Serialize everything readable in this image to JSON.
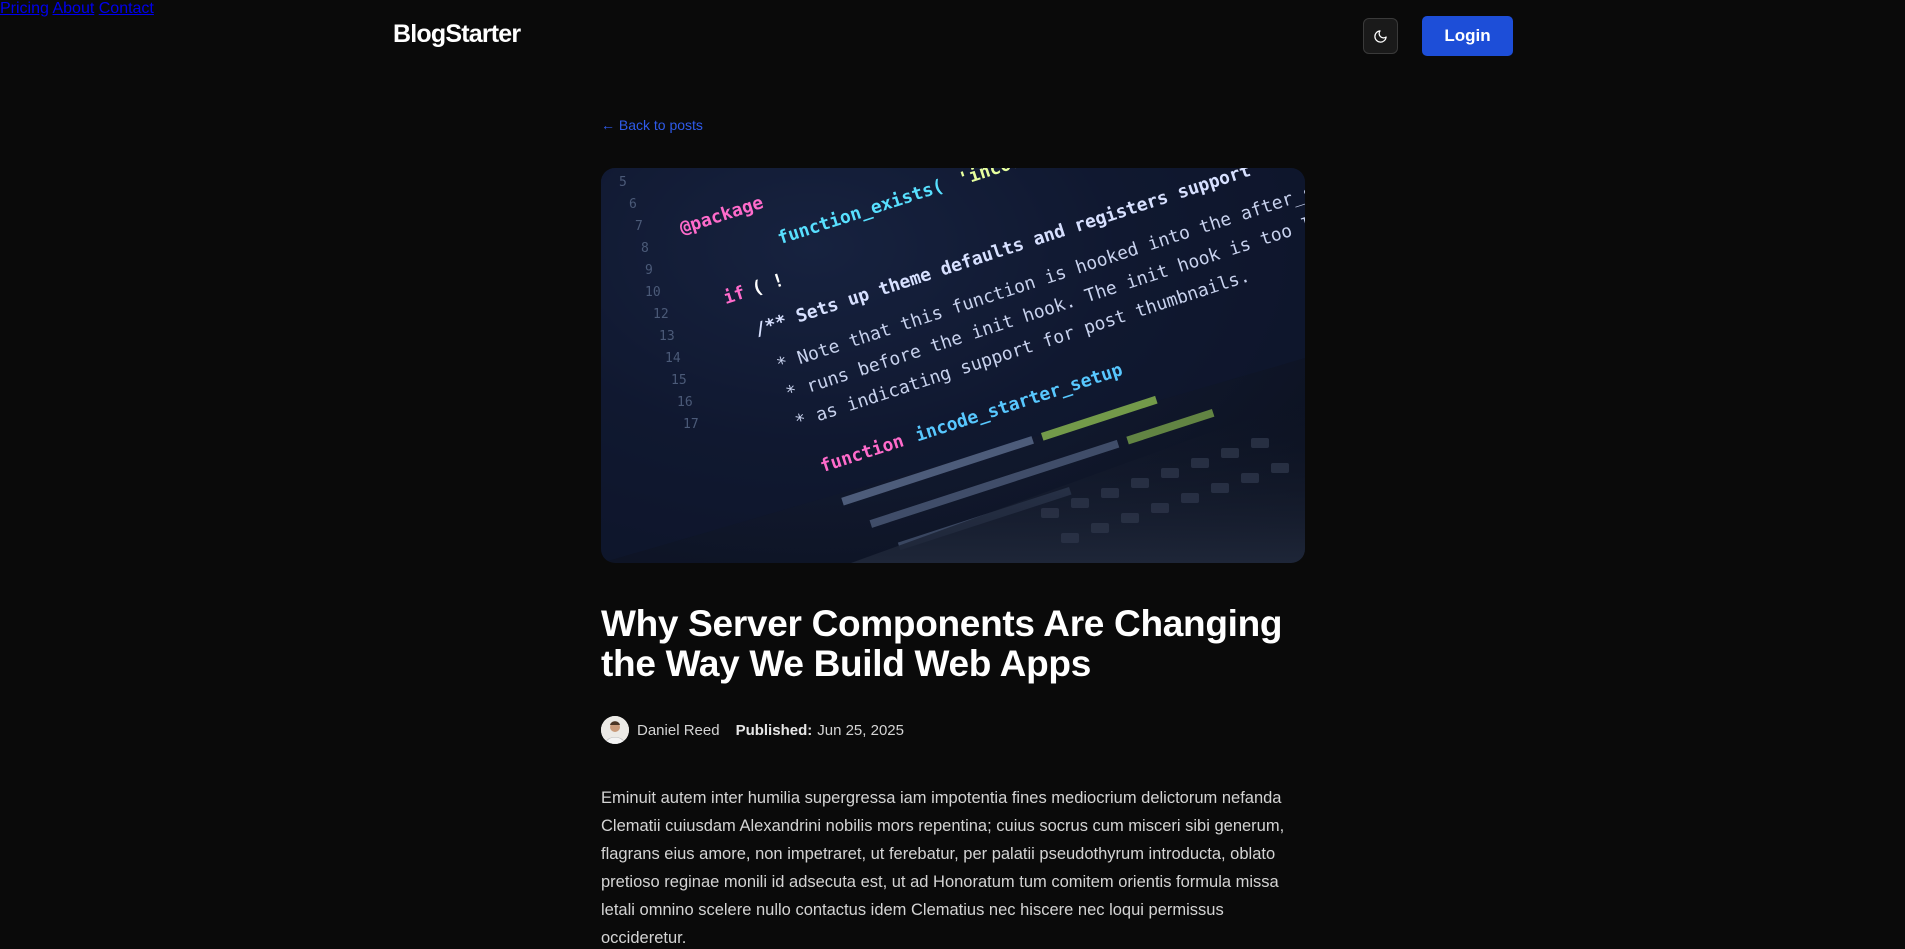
{
  "header": {
    "brand": "BlogStarter",
    "nav": [
      {
        "label": "Pricing"
      },
      {
        "label": "About"
      },
      {
        "label": "Contact"
      }
    ],
    "theme_toggle_icon": "moon-icon",
    "login_label": "Login"
  },
  "back_link": "← Back to posts",
  "post": {
    "hero_image_icon": "code-editor-laptop-photo",
    "title": "Why Server Components Are Changing the Way We Build Web Apps",
    "author": "Daniel Reed",
    "published_label": "Published:",
    "published_date": "Jun 25, 2025",
    "body": "Eminuit autem inter humilia supergressa iam impotentia fines mediocrium delictorum nefanda Clematii cuiusdam Alexandrini nobilis mors repentina; cuius socrus cum misceri sibi generum, flagrans eius amore, non impetraret, ut ferebatur, per palatii pseudothyrum introducta, oblato pretioso reginae monili id adsecuta est, ut ad Honoratum tum comitem orientis formula missa letali omnino scelere nullo contactus idem Clematius nec hiscere nec loqui permissus occideretur."
  },
  "colors": {
    "background": "#0a0a0a",
    "accent": "#1d4ed8",
    "link": "#2f5bea"
  }
}
